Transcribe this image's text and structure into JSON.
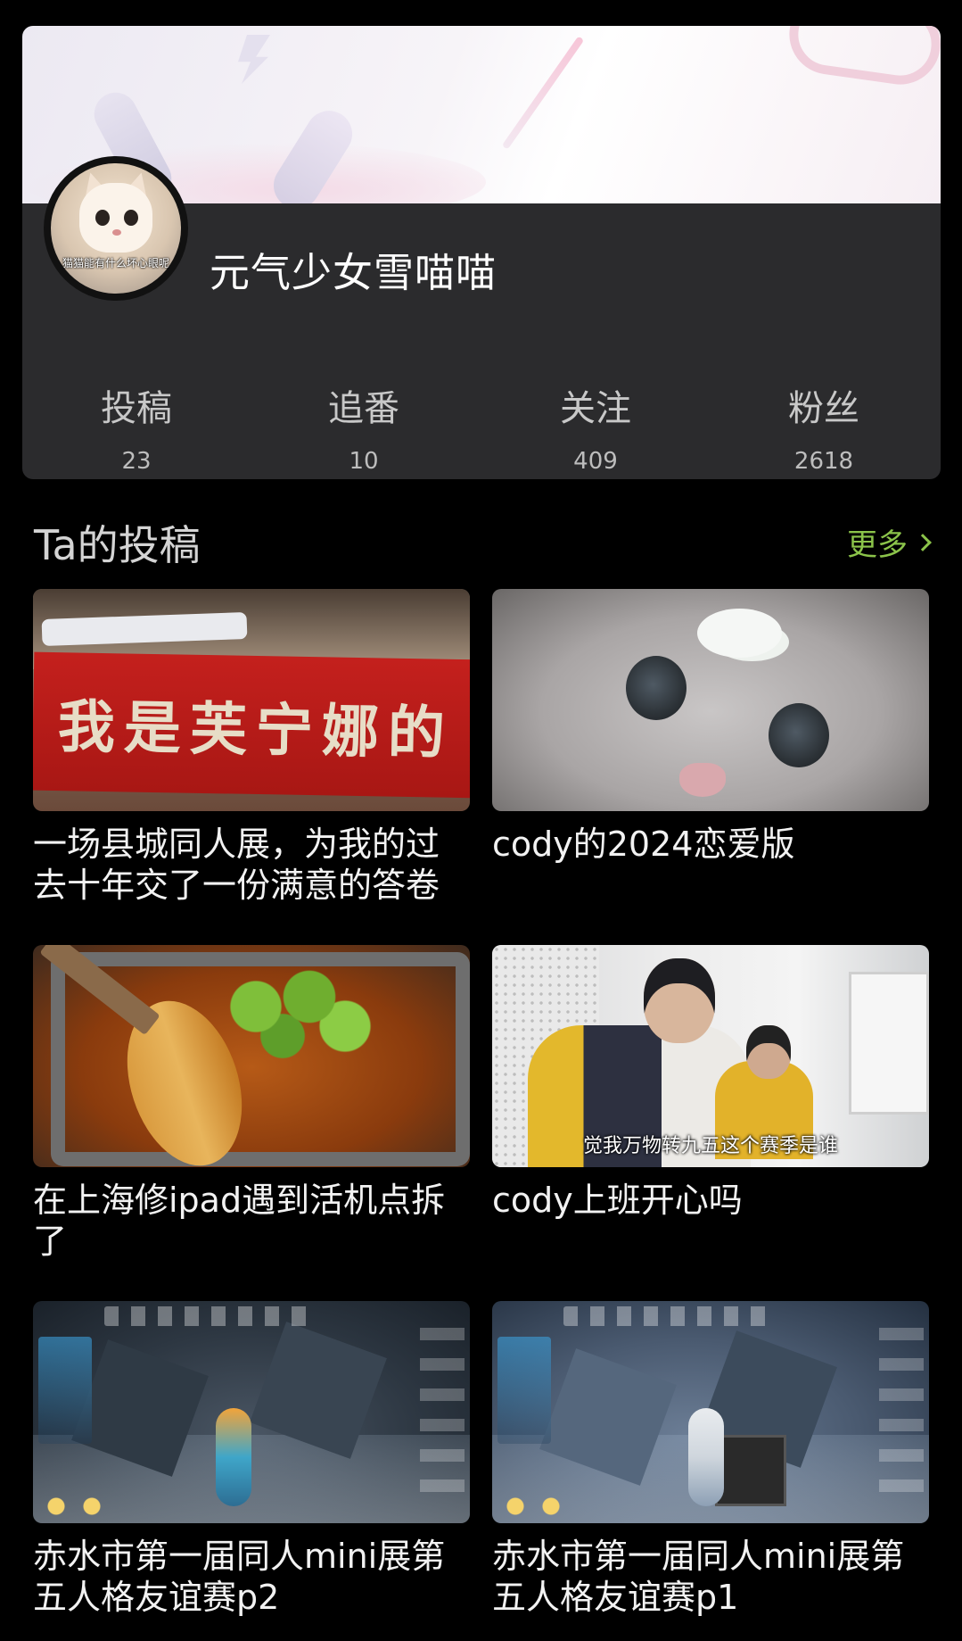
{
  "profile": {
    "username": "元气少女雪喵喵",
    "avatar_caption": "猫猫能有什么坏心眼呢",
    "stats": [
      {
        "label": "投稿",
        "value": "23"
      },
      {
        "label": "追番",
        "value": "10"
      },
      {
        "label": "关注",
        "value": "409"
      },
      {
        "label": "粉丝",
        "value": "2618"
      }
    ]
  },
  "submissions": {
    "title": "Ta的投稿",
    "more_label": "更多",
    "more_icon": "chevron-right-icon",
    "accent_color": "#8bc34a",
    "videos": [
      {
        "title": "一场县城同人展，为我的过去十年交了一份满意的答卷",
        "thumb_text": "我是芙宁娜的"
      },
      {
        "title": "cody的2024恋爱版",
        "thumb_text": ""
      },
      {
        "title": "在上海修ipad遇到活机点拆了",
        "thumb_text": ""
      },
      {
        "title": "cody上班开心吗",
        "thumb_text": "觉我万物转九五这个赛季是谁"
      },
      {
        "title": "赤水市第一届同人mini展第五人格友谊赛p2",
        "thumb_text": ""
      },
      {
        "title": "赤水市第一届同人mini展第五人格友谊赛p1",
        "thumb_text": ""
      }
    ]
  }
}
